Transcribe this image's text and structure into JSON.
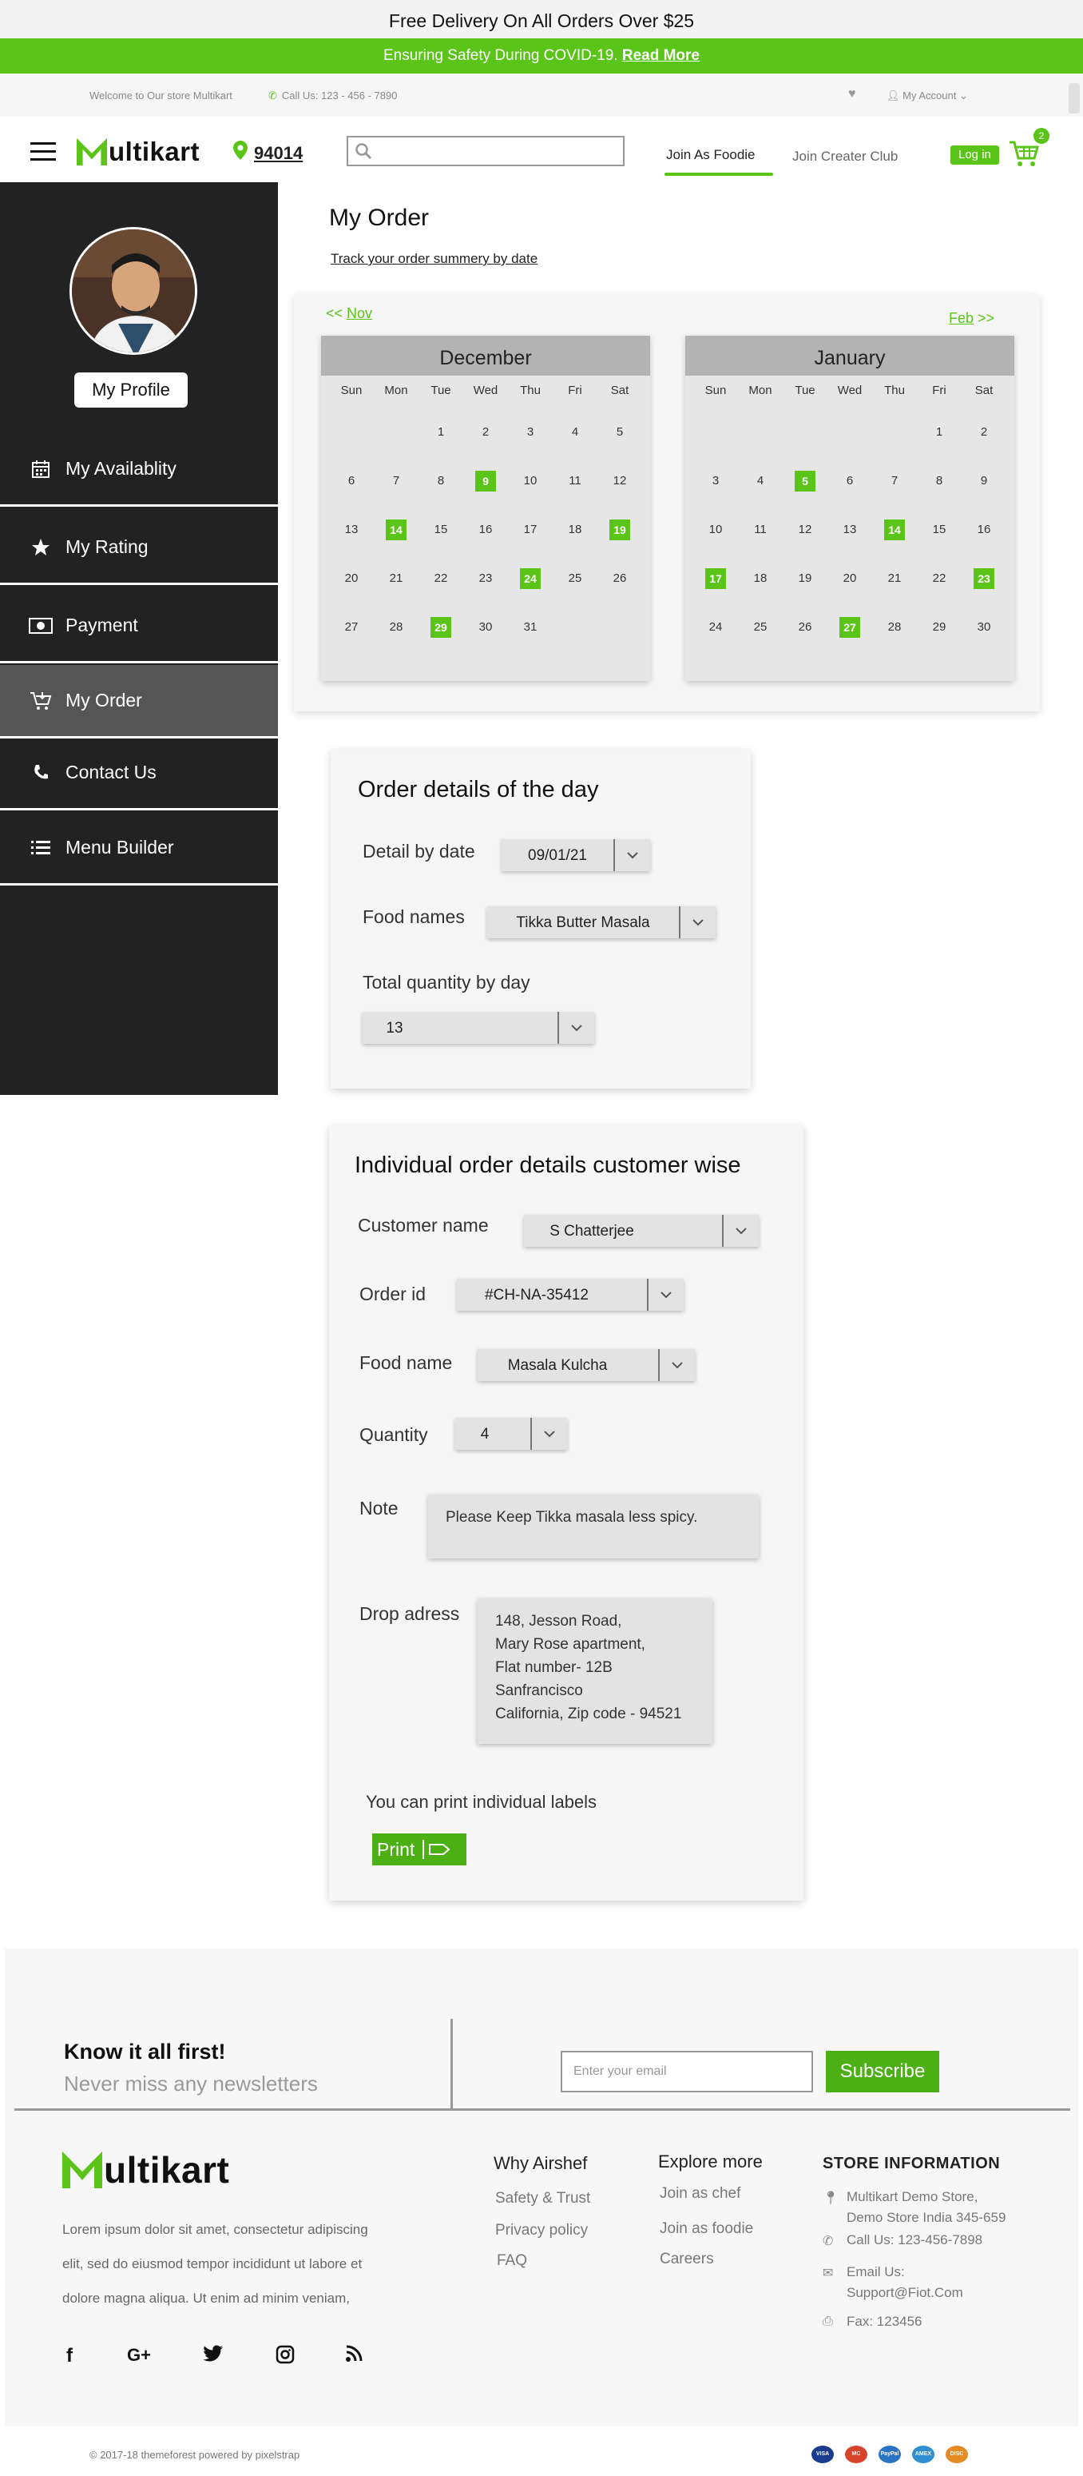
{
  "top_bar": {
    "delivery": "Free Delivery On All Orders Over $25",
    "covid_text": "Ensuring Safety During COVID-19.",
    "covid_link": "Read More",
    "welcome": "Welcome to Our store Multikart",
    "call": "Call Us: 123 - 456 - 7890",
    "account": "My Account"
  },
  "header": {
    "logo_first": "M",
    "logo_rest": "ultikart",
    "zip": "94014",
    "search_placeholder": "",
    "tab_foodie": "Join As Foodie",
    "tab_club": "Join Creater Club",
    "login": "Log in",
    "cart_count": "2"
  },
  "sidebar": {
    "profile_button": "My Profile",
    "items": [
      {
        "label": "My Availablity",
        "icon": "calendar-icon"
      },
      {
        "label": "My Rating",
        "icon": "star-icon"
      },
      {
        "label": "Payment",
        "icon": "money-icon"
      },
      {
        "label": "My Order",
        "icon": "cart-icon",
        "active": true
      },
      {
        "label": "Contact Us",
        "icon": "phone-icon"
      },
      {
        "label": "Menu Builder",
        "icon": "list-icon"
      }
    ]
  },
  "main": {
    "title": "My Order",
    "track_link": "Track your order summery by date"
  },
  "calendars": {
    "prev": "<< Nov",
    "prev_month": "Nov",
    "next_month": "Feb",
    "weekdays": [
      "Sun",
      "Mon",
      "Tue",
      "Wed",
      "Thu",
      "Fri",
      "Sat"
    ],
    "months": [
      {
        "name": "December",
        "weeks": [
          [
            "",
            "",
            "1",
            "2",
            "3",
            "4",
            "5"
          ],
          [
            "6",
            "7",
            "8",
            "9",
            "10",
            "11",
            "12"
          ],
          [
            "13",
            "14",
            "15",
            "16",
            "17",
            "18",
            "19"
          ],
          [
            "20",
            "21",
            "22",
            "23",
            "24",
            "25",
            "26"
          ],
          [
            "27",
            "28",
            "29",
            "30",
            "31",
            "",
            ""
          ]
        ],
        "highlighted": [
          "9",
          "14",
          "19",
          "24",
          "29"
        ]
      },
      {
        "name": "January",
        "weeks": [
          [
            "",
            "",
            "",
            "",
            "",
            "1",
            "2"
          ],
          [
            "3",
            "4",
            "5",
            "6",
            "7",
            "8",
            "9"
          ],
          [
            "10",
            "11",
            "12",
            "13",
            "14",
            "15",
            "16"
          ],
          [
            "17",
            "18",
            "19",
            "20",
            "21",
            "22",
            "23"
          ],
          [
            "24",
            "25",
            "26",
            "27",
            "28",
            "29",
            "30"
          ]
        ],
        "highlighted": [
          "5",
          "14",
          "17",
          "23",
          "27"
        ]
      }
    ]
  },
  "day_details": {
    "title": "Order details of the day",
    "date_label": "Detail by date",
    "date_value": "09/01/21",
    "food_label": "Food names",
    "food_value": "Tikka Butter Masala",
    "qty_label": "Total quantity by day",
    "qty_value": "13"
  },
  "customer_details": {
    "title": "Individual order details customer wise",
    "customer_label": "Customer name",
    "customer_value": "S Chatterjee",
    "order_label": "Order id",
    "order_value": "#CH-NA-35412",
    "food_label": "Food name",
    "food_value": "Masala Kulcha",
    "qty_label": "Quantity",
    "qty_value": "4",
    "note_label": "Note",
    "note_value": "Please Keep Tikka masala less spicy.",
    "address_label": "Drop adress",
    "address_lines": [
      "148, Jesson Road,",
      "Mary Rose apartment,",
      "Flat number- 12B",
      "Sanfrancisco",
      "California, Zip code - 94521"
    ],
    "print_hint": "You can print individual labels",
    "print_button": "Print"
  },
  "footer": {
    "newsletter_title": "Know it all first!",
    "newsletter_sub": "Never miss any newsletters",
    "email_placeholder": "Enter your email",
    "subscribe": "Subscribe",
    "about_lines": [
      "Lorem ipsum dolor sit amet, consectetur adipiscing",
      "elit, sed do eiusmod tempor incididunt ut labore et",
      "dolore magna aliqua. Ut enim ad minim veniam,"
    ],
    "social": [
      "facebook-icon",
      "google-plus-icon",
      "twitter-icon",
      "instagram-icon",
      "rss-icon"
    ],
    "col1_title": "Why Airshef",
    "col1_links": [
      "Safety & Trust",
      "Privacy policy",
      "FAQ"
    ],
    "col2_title": "Explore more",
    "col2_links": [
      "Join as chef",
      "Join as foodie",
      "Careers"
    ],
    "store_title": "STORE INFORMATION",
    "store_address": [
      "Multikart Demo Store,",
      "Demo Store India 345-659"
    ],
    "store_phone": "Call Us: 123-456-7898",
    "store_email": [
      "Email Us:",
      "Support@Fiot.Com"
    ],
    "store_fax": "Fax: 123456",
    "copyright": "© 2017-18 themeforest powered by pixelstrap",
    "payments": [
      "VISA",
      "MC",
      "PayPal",
      "AMEX",
      "DISC"
    ]
  },
  "colors": {
    "accent": "#5bc418",
    "sidebar": "#222222",
    "active": "#555555"
  }
}
